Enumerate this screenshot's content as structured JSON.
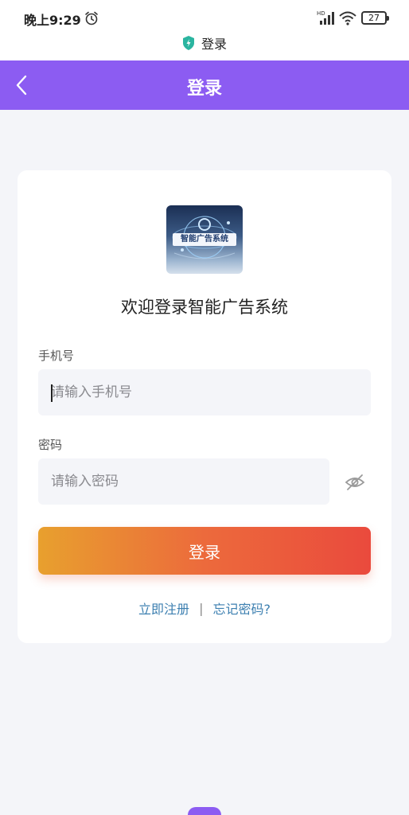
{
  "status_bar": {
    "time": "晚上9:29",
    "battery": "27",
    "network_badge": "HD"
  },
  "page_caption": {
    "title": "登录"
  },
  "nav": {
    "title": "登录"
  },
  "card": {
    "logo_text": "智能广告系统",
    "welcome": "欢迎登录智能广告系统",
    "phone_label": "手机号",
    "phone_placeholder": "请输入手机号",
    "password_label": "密码",
    "password_placeholder": "请输入密码",
    "login_button": "登录",
    "register_link": "立即注册",
    "separator": "|",
    "forgot_link": "忘记密码?"
  },
  "colors": {
    "accent": "#8c5cf2",
    "button_start": "#e8a02e",
    "button_end": "#ea4a3d",
    "link": "#3c7fb0"
  }
}
